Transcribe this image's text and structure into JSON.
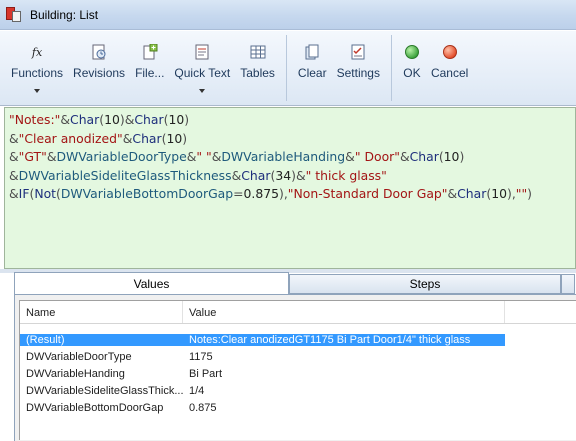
{
  "window": {
    "title": "Building: List"
  },
  "toolbar": {
    "functions": "Functions",
    "revisions": "Revisions",
    "file": "File...",
    "quick_text": "Quick Text",
    "tables": "Tables",
    "clear": "Clear",
    "settings": "Settings",
    "ok": "OK",
    "cancel": "Cancel",
    "ok_color": "#3cb043",
    "cancel_color": "#e8452c"
  },
  "editor": {
    "l1": {
      "s1": "\"Notes:\"",
      "o1": "&",
      "f1": "Char",
      "p1": "(",
      "n1": "10",
      "p2": ")",
      "o2": "&",
      "f2": "Char",
      "p3": "(",
      "n2": "10",
      "p4": ")"
    },
    "l2": {
      "o1": "&",
      "s1": "\"Clear anodized\"",
      "o2": "&",
      "f1": "Char",
      "p1": "(",
      "n1": "10",
      "p2": ")"
    },
    "l3": {
      "o1": "&",
      "s1": "\"GT\"",
      "o2": "&",
      "v1": "DWVariableDoorType",
      "o3": "&",
      "s2": "\" \"",
      "o4": "&",
      "v2": "DWVariableHanding",
      "o5": "&",
      "s3": "\" Door\"",
      "o6": "&",
      "f1": "Char",
      "p1": "(",
      "n1": "10",
      "p2": ")"
    },
    "l4": {
      "o1": "&",
      "v1": "DWVariableSideliteGlassThickness",
      "o2": "&",
      "f1": "Char",
      "p1": "(",
      "n1": "34",
      "p2": ")",
      "o3": "&",
      "s1": "\" thick glass\""
    },
    "l5": {
      "o1": "&",
      "f1": "IF",
      "p1": "(",
      "f2": "Not",
      "p2": "(",
      "v1": "DWVariableBottomDoorGap",
      "o2": "=",
      "n1": "0.875",
      "p3": "),",
      "s1": "\"Non-Standard Door Gap\"",
      "o3": "&",
      "f3": "Char",
      "p4": "(",
      "n2": "10",
      "p5": "),",
      "s2": "\"\"",
      "p6": ")"
    }
  },
  "tabs": {
    "values": "Values",
    "steps": "Steps"
  },
  "grid": {
    "headers": {
      "name": "Name",
      "value": "Value"
    },
    "rows": [
      {
        "name": "(Result)",
        "value": "Notes:Clear anodizedGT1175 Bi Part Door1/4\" thick glass"
      },
      {
        "name": "DWVariableDoorType",
        "value": "1175"
      },
      {
        "name": "DWVariableHanding",
        "value": "Bi Part"
      },
      {
        "name": "DWVariableSideliteGlassThick...",
        "value": "1/4"
      },
      {
        "name": "DWVariableBottomDoorGap",
        "value": "0.875"
      }
    ]
  }
}
